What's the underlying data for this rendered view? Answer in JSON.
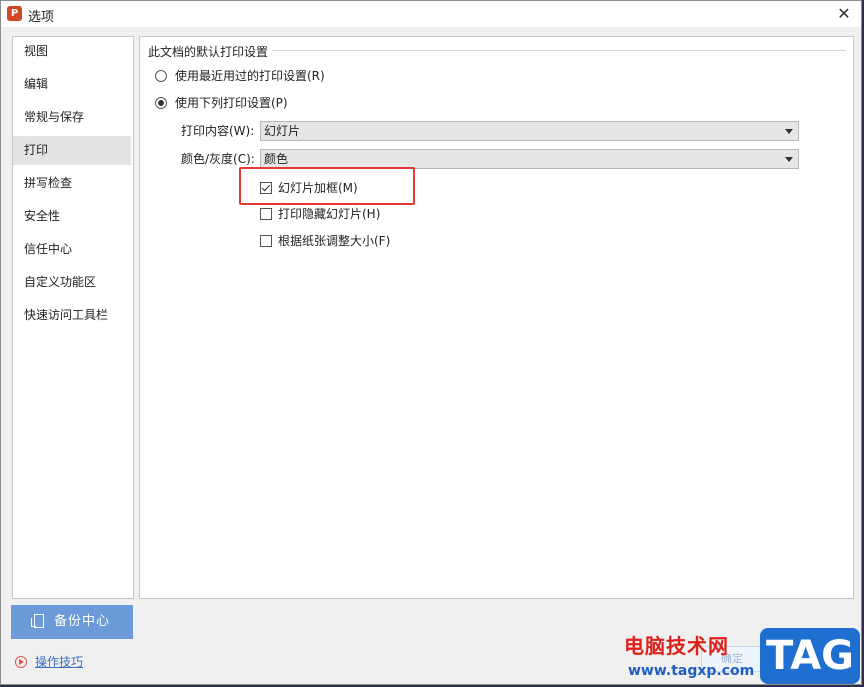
{
  "window": {
    "title": "选项",
    "app_icon_letter": "P"
  },
  "sidebar": {
    "items": [
      {
        "label": "视图"
      },
      {
        "label": "编辑"
      },
      {
        "label": "常规与保存"
      },
      {
        "label": "打印",
        "active": true
      },
      {
        "label": "拼写检查"
      },
      {
        "label": "安全性"
      },
      {
        "label": "信任中心"
      },
      {
        "label": "自定义功能区"
      },
      {
        "label": "快速访问工具栏"
      }
    ],
    "backup_label": "备份中心",
    "tips_label": "操作技巧"
  },
  "print_settings": {
    "group_title": "此文档的默认打印设置",
    "radio_recent": {
      "label": "使用最近用过的打印设置(R)",
      "checked": false
    },
    "radio_following": {
      "label": "使用下列打印设置(P)",
      "checked": true
    },
    "content_label": "打印内容(W):",
    "content_value": "幻灯片",
    "color_label": "颜色/灰度(C):",
    "color_value": "颜色",
    "options": [
      {
        "label": "幻灯片加框(M)",
        "checked": true
      },
      {
        "label": "打印隐藏幻灯片(H)",
        "checked": false
      },
      {
        "label": "根据纸张调整大小(F)",
        "checked": false
      }
    ]
  },
  "footer": {
    "ok_label": "确定"
  },
  "watermark": {
    "site_cn": "电脑技术网",
    "url": "www.tagxp.com",
    "tag": "TAG"
  },
  "colors": {
    "highlight": "#e53935",
    "backup_button": "#6b9bd8",
    "accent_link": "#3a6fc4"
  }
}
